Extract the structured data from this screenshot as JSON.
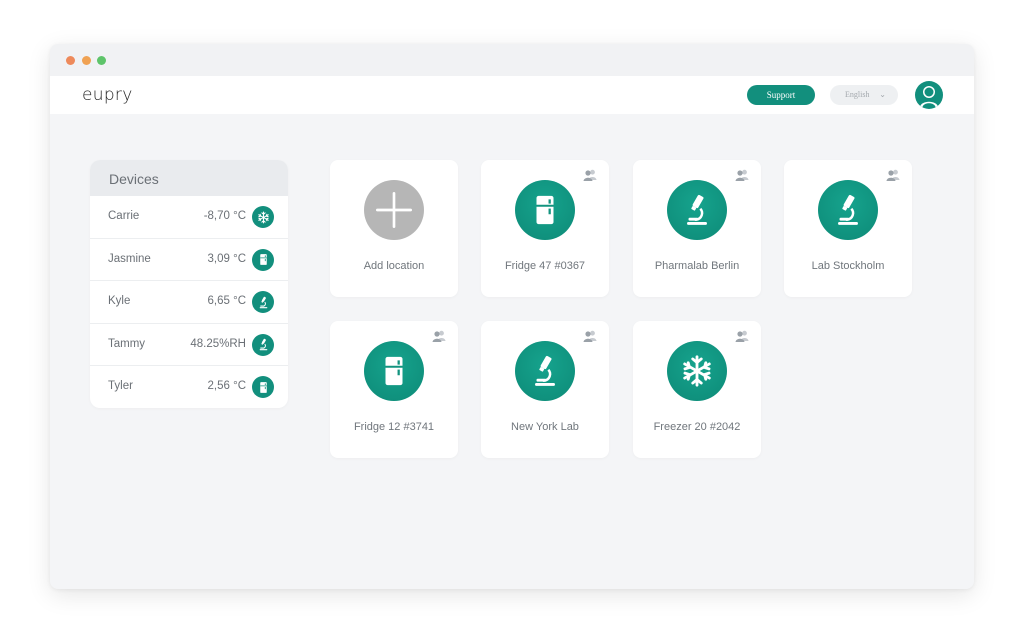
{
  "window": {
    "controls": [
      "close",
      "minimize",
      "maximize"
    ]
  },
  "header": {
    "brand": "eupry",
    "support_label": "Support",
    "language": {
      "selected": "English"
    },
    "avatar_icon": "user-avatar-icon"
  },
  "devices": {
    "title": "Devices",
    "items": [
      {
        "name": "Carrie",
        "value": "-8,70 °C",
        "icon": "snowflake-icon"
      },
      {
        "name": "Jasmine",
        "value": "3,09 °C",
        "icon": "fridge-icon"
      },
      {
        "name": "Kyle",
        "value": "6,65 °C",
        "icon": "microscope-icon"
      },
      {
        "name": "Tammy",
        "value": "48.25%RH",
        "icon": "microscope-icon"
      },
      {
        "name": "Tyler",
        "value": "2,56 °C",
        "icon": "fridge-icon"
      }
    ]
  },
  "locations": [
    {
      "label": "Add location",
      "icon": "plus-icon",
      "shared": false
    },
    {
      "label": "Fridge 47 #0367",
      "icon": "fridge-icon",
      "shared": true
    },
    {
      "label": "Pharmalab Berlin",
      "icon": "microscope-icon",
      "shared": true
    },
    {
      "label": "Lab Stockholm",
      "icon": "microscope-icon",
      "shared": true
    },
    {
      "label": "Fridge 12 #3741",
      "icon": "fridge-icon",
      "shared": true
    },
    {
      "label": "New York Lab",
      "icon": "microscope-icon",
      "shared": true
    },
    {
      "label": "Freezer 20 #2042",
      "icon": "snowflake-icon",
      "shared": true
    }
  ],
  "colors": {
    "accent": "#128f7d",
    "add_circle": "#b6b6b6",
    "background": "#f4f5f7"
  }
}
